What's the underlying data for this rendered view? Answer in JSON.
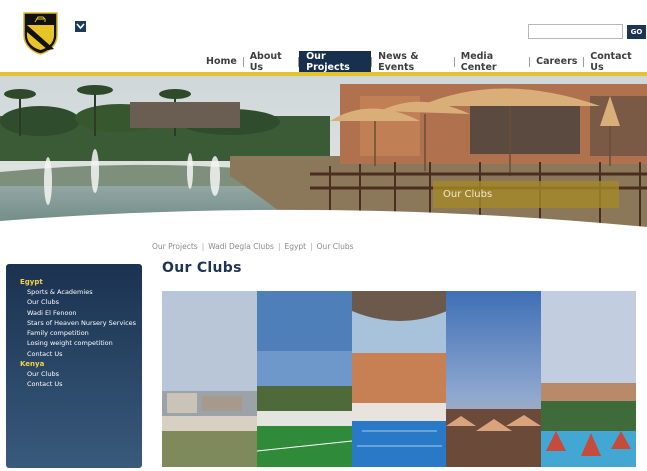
{
  "header": {
    "logo_icon": "club-crest-icon",
    "lang_icon": "chevron-down-icon",
    "search": {
      "value": "",
      "placeholder": ""
    },
    "go_label": "GO"
  },
  "nav": {
    "items": [
      {
        "label": "Home"
      },
      {
        "label": "About Us"
      },
      {
        "label": "Our Projects",
        "active": true
      },
      {
        "label": "News & Events"
      },
      {
        "label": "Media Center"
      },
      {
        "label": "Careers"
      },
      {
        "label": "Contact Us"
      }
    ]
  },
  "banner": {
    "caption": "Our Clubs"
  },
  "breadcrumb": [
    "Our Projects",
    "Wadi Degla Clubs",
    "Egypt",
    "Our Clubs"
  ],
  "page_title": "Our Clubs",
  "sidebar": {
    "groups": [
      {
        "label": "Egypt",
        "items": [
          "Sports & Academies",
          "Our Clubs",
          "Wadi El Fenoon",
          "Stars of Heaven Nursery Services",
          "Family competition",
          "Losing weight competition",
          "Contact Us"
        ]
      },
      {
        "label": "Kenya",
        "items": [
          "Our Clubs",
          "Contact Us"
        ]
      }
    ]
  },
  "colors": {
    "navy": "#17304e",
    "gold": "#e2c52c",
    "caption": "#a48828"
  }
}
